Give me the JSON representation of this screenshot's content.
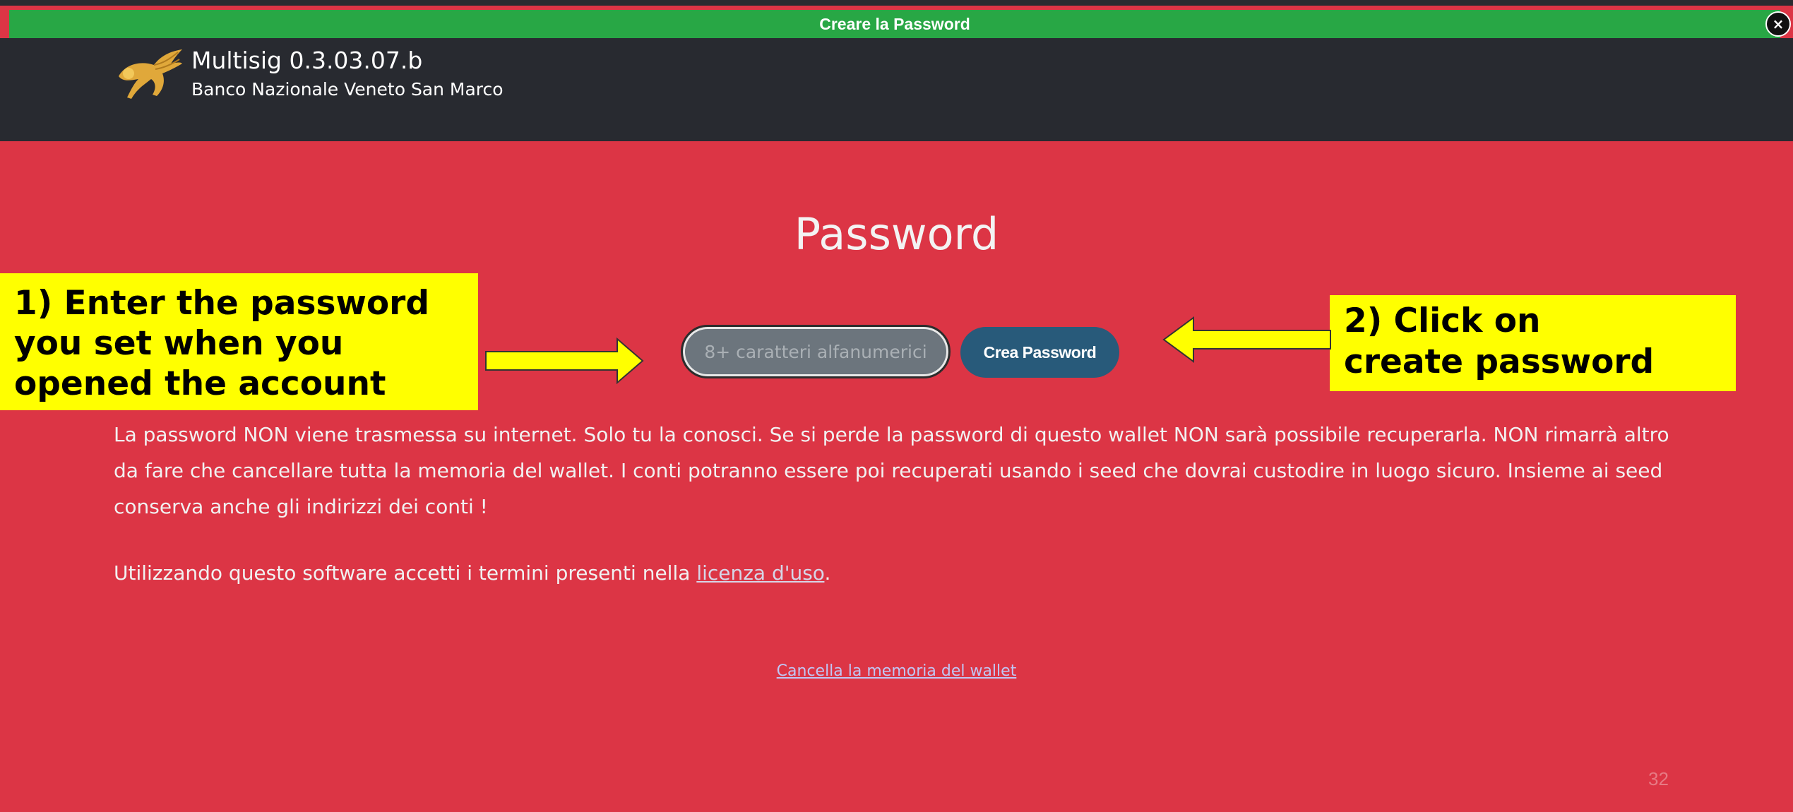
{
  "window": {
    "title": "Creare la Password",
    "close_icon": "×"
  },
  "header": {
    "app_name": "Multisig 0.3.03.07.b",
    "bank_name": "Banco Nazionale Veneto San Marco",
    "logo_icon": "winged-lion-icon"
  },
  "main": {
    "title": "Password",
    "password_placeholder": "8+ caratteri alfanumerici",
    "password_value": "",
    "create_button_label": "Crea Password",
    "note": "La password  NON viene trasmessa su internet. Solo tu la conosci.  Se si perde la password di questo wallet NON sarà possibile recuperarla. NON rimarrà altro da fare che cancellare tutta la memoria del wallet. I conti potranno essere poi recuperati usando i seed che dovrai custodire in luogo sicuro. Insieme ai seed conserva anche gli indirizzi dei conti !",
    "terms_prefix": "Utilizzando questo software accetti i termini presenti nella ",
    "terms_link": "licenza d'uso",
    "terms_suffix": ".",
    "wipe_link": "Cancella la memoria del wallet"
  },
  "annotations": {
    "callout_1": [
      "1) Enter the password",
      "you set when you",
      "opened the account"
    ],
    "callout_2": [
      "2) Click on",
      "create password"
    ]
  },
  "colors": {
    "titlebar": "#28a745",
    "header": "#282a30",
    "background": "#dc3545",
    "button": "#285a7a",
    "callout": "#ffff00"
  },
  "slide_number": "32"
}
